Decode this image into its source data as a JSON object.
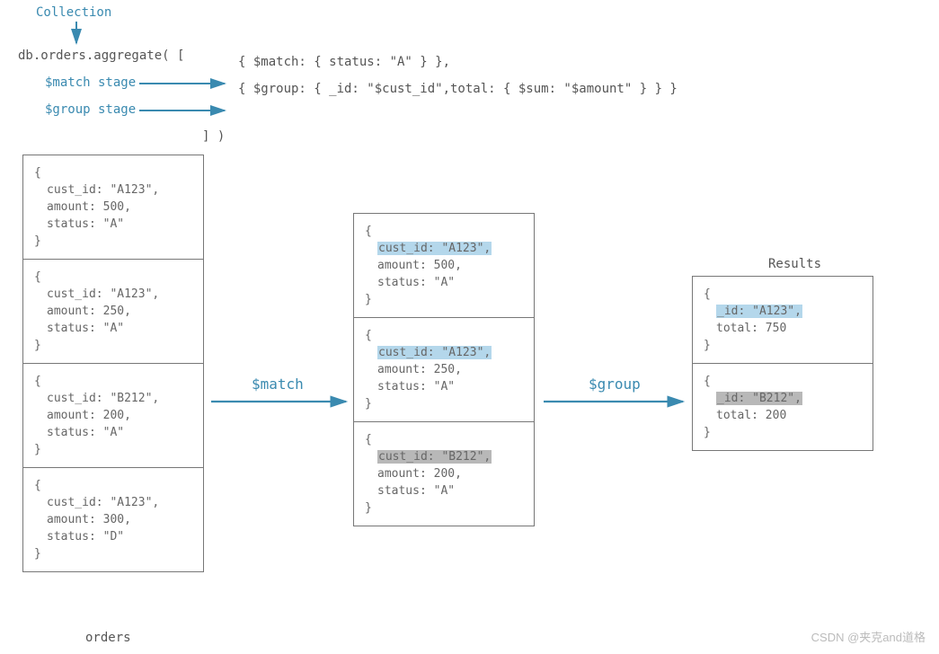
{
  "header": {
    "collection_label": "Collection",
    "query_start": "db.orders.aggregate( [",
    "match_stage_label": "$match stage",
    "group_stage_label": "$group stage",
    "match_line": "{ $match: { status: \"A\" } },",
    "group_line": "{ $group: { _id: \"$cust_id\",total: { $sum: \"$amount\" } } }",
    "close": "] )"
  },
  "orders_caption": "orders",
  "results_caption": "Results",
  "stage1_label": "$match",
  "stage2_label": "$group",
  "watermark": "CSDN @夹克and道格",
  "orders": [
    {
      "line1": "cust_id: \"A123\",",
      "line2": "amount: 500,",
      "line3": "status: \"A\""
    },
    {
      "line1": "cust_id: \"A123\",",
      "line2": "amount: 250,",
      "line3": "status: \"A\""
    },
    {
      "line1": "cust_id: \"B212\",",
      "line2": "amount: 200,",
      "line3": "status: \"A\""
    },
    {
      "line1": "cust_id: \"A123\",",
      "line2": "amount: 300,",
      "line3": "status: \"D\""
    }
  ],
  "matched": [
    {
      "line1": "cust_id: \"A123\",",
      "line2": "amount: 500,",
      "line3": "status: \"A\"",
      "hl": "blue"
    },
    {
      "line1": "cust_id: \"A123\",",
      "line2": "amount: 250,",
      "line3": "status: \"A\"",
      "hl": "blue"
    },
    {
      "line1": "cust_id: \"B212\",",
      "line2": "amount: 200,",
      "line3": "status: \"A\"",
      "hl": "gray"
    }
  ],
  "results": [
    {
      "line1": "_id: \"A123\",",
      "line2": "total: 750",
      "hl": "blue"
    },
    {
      "line1": "_id: \"B212\",",
      "line2": "total: 200",
      "hl": "gray"
    }
  ]
}
